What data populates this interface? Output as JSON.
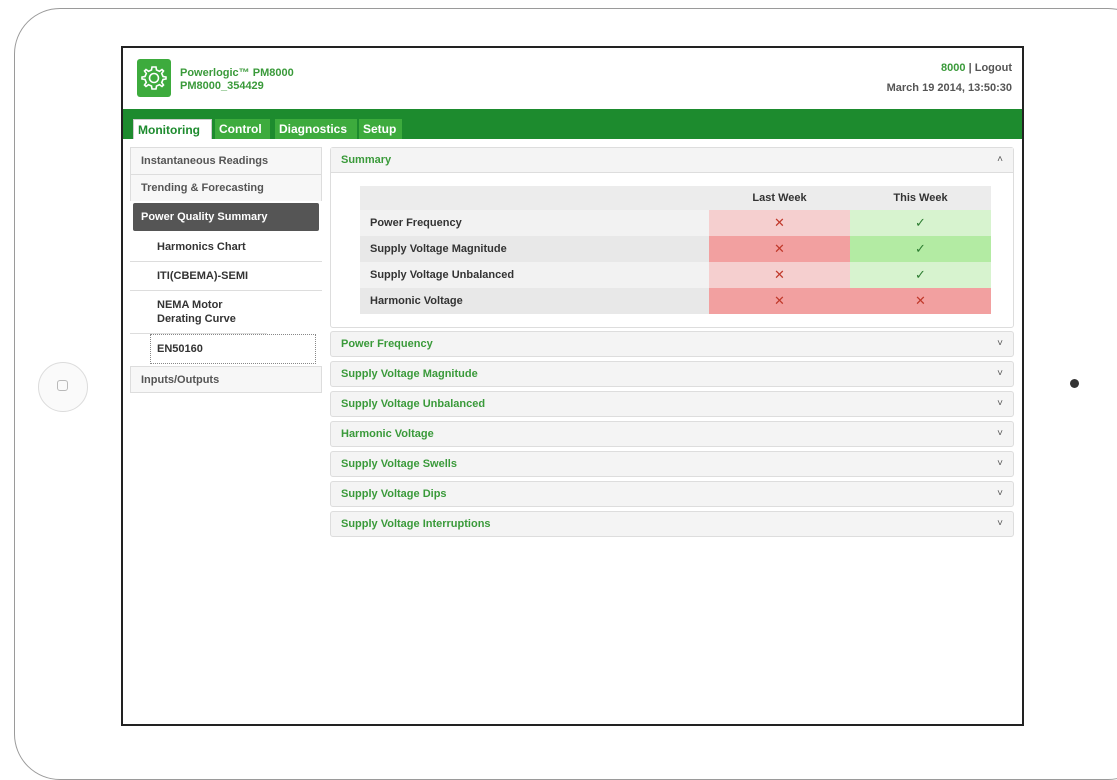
{
  "app": {
    "product": "Powerlogic™ PM8000",
    "device_id": "PM8000_354429",
    "user": "8000",
    "separator": "|",
    "logout": "Logout",
    "datetime": "March 19 2014, 13:50:30",
    "logo_icon": "gear-icon"
  },
  "tabs": [
    {
      "label": "Monitoring",
      "active": true
    },
    {
      "label": "Control"
    },
    {
      "label": "Diagnostics"
    },
    {
      "label": "Setup"
    }
  ],
  "sidebar": {
    "items": [
      {
        "label": "Instantaneous Readings"
      },
      {
        "label": "Trending & Forecasting"
      },
      {
        "label": "Power Quality Summary",
        "active": true
      },
      {
        "label": "Inputs/Outputs"
      }
    ],
    "subitems": [
      {
        "label": "Harmonics Chart"
      },
      {
        "label": "ITI(CBEMA)-SEMI"
      },
      {
        "label": "NEMA Motor Derating Curve"
      },
      {
        "label": "EN50160",
        "focused": true
      }
    ]
  },
  "summary": {
    "title": "Summary",
    "expanded": true,
    "columns": [
      "",
      "Last Week",
      "This Week"
    ],
    "rows": [
      {
        "label": "Power Frequency",
        "last_week": "✕",
        "this_week": "✓"
      },
      {
        "label": "Supply Voltage Magnitude",
        "last_week": "✕",
        "this_week": "✓"
      },
      {
        "label": "Supply Voltage Unbalanced",
        "last_week": "✕",
        "this_week": "✓"
      },
      {
        "label": "Harmonic Voltage",
        "last_week": "✕",
        "this_week": "✕"
      }
    ],
    "colors": {
      "fail_light": "#f5cfcf",
      "fail_dark": "#f2a0a0",
      "pass_light": "#d7f3cf",
      "pass_dark": "#b3eba3"
    }
  },
  "accordions": [
    {
      "label": "Power Frequency"
    },
    {
      "label": "Supply Voltage Magnitude"
    },
    {
      "label": "Supply Voltage Unbalanced"
    },
    {
      "label": "Harmonic Voltage"
    },
    {
      "label": "Supply Voltage Swells"
    },
    {
      "label": "Supply Voltage Dips"
    },
    {
      "label": "Supply Voltage Interruptions"
    }
  ],
  "colors": {
    "brand_green": "#3dab3d",
    "tabbar_green": "#1d8b2e"
  }
}
